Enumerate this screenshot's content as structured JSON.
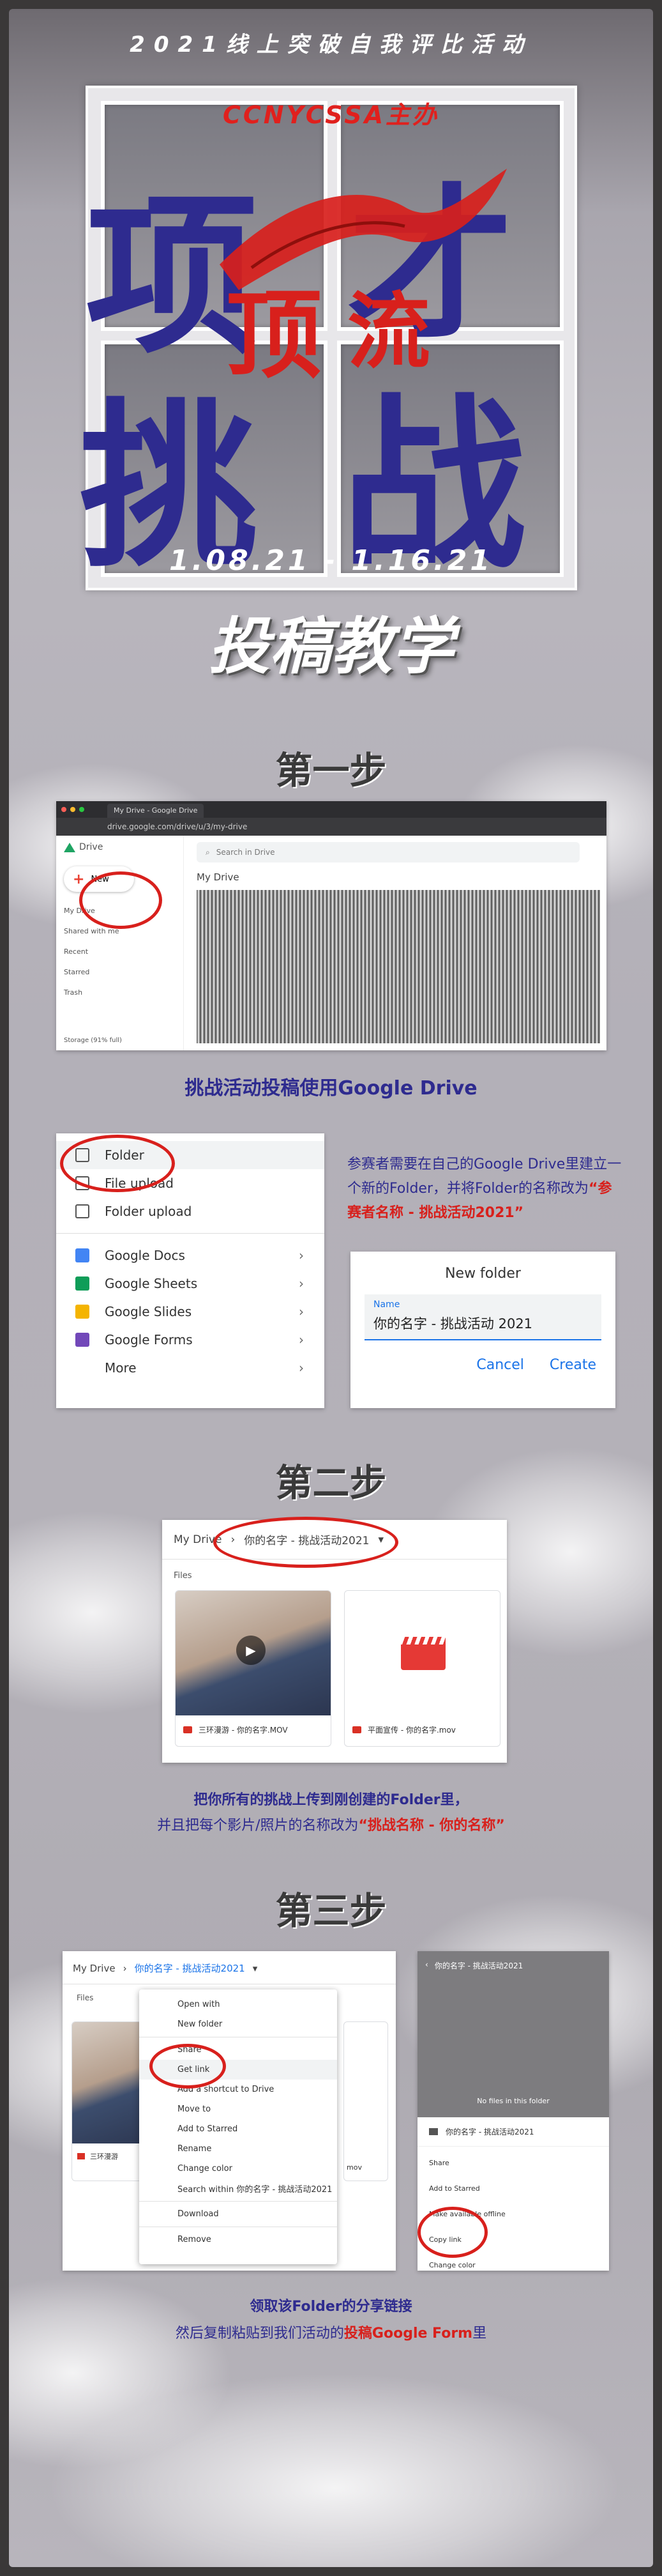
{
  "header": {
    "slogan": "2021线上突破自我评比活动",
    "organizer": "CCNYCSSA主办",
    "big_title_top": [
      "项",
      "才"
    ],
    "big_title_bottom": [
      "挑",
      "战"
    ],
    "big_title_red": [
      "顶",
      "流"
    ],
    "date_range": "1.08.21 - 1.16.21",
    "main_title": "投稿教学"
  },
  "steps": [
    {
      "title": "第一步"
    },
    {
      "title": "第二步"
    },
    {
      "title": "第三步"
    }
  ],
  "step1": {
    "browser": {
      "tab": "My Drive - Google Drive",
      "url": "drive.google.com/drive/u/3/my-drive",
      "app_name": "Drive",
      "search_placeholder": "Search in Drive",
      "breadcrumb": "My Drive",
      "new_button": "New",
      "nav": [
        "My Drive",
        "Shared with me",
        "Recent",
        "Starred",
        "Trash"
      ],
      "storage": "Storage (91% full)"
    },
    "caption": "挑战活动投稿使用Google Drive",
    "new_menu": {
      "items_top": [
        "Folder",
        "File upload",
        "Folder upload"
      ],
      "items_apps": [
        {
          "label": "Google Docs",
          "color": "#4285f4"
        },
        {
          "label": "Google Sheets",
          "color": "#0f9d58"
        },
        {
          "label": "Google Slides",
          "color": "#f4b400"
        },
        {
          "label": "Google Forms",
          "color": "#7248b9"
        },
        {
          "label": "More",
          "color": ""
        }
      ]
    },
    "description": {
      "line1": "参赛者需要在自己的Google Drive里建立一个新的Folder，并将Folder的名称改为",
      "highlight": "“参赛者名称 - 挑战活动2021”"
    },
    "new_folder_dialog": {
      "title": "New folder",
      "field_label": "Name",
      "field_value": "你的名字 - 挑战活动 2021",
      "cancel": "Cancel",
      "create": "Create"
    }
  },
  "step2": {
    "breadcrumb_root": "My Drive",
    "breadcrumb_folder": "你的名字 - 挑战活动2021",
    "section_label": "Files",
    "files": [
      {
        "name": "三环漫游 - 你的名字.MOV"
      },
      {
        "name": "平面宣传 - 你的名字.mov"
      }
    ],
    "caption_line1": "把你所有的挑战上传到刚创建的Folder里，",
    "caption_line2_pre": "并且把每个影片/照片的名称改为",
    "caption_line2_highlight": "“挑战名称 - 你的名称”"
  },
  "step3": {
    "breadcrumb_root": "My Drive",
    "breadcrumb_folder": "你的名字 - 挑战活动2021",
    "section_label": "Files",
    "file_left": "三环漫游",
    "file_right": "mov",
    "context_menu": [
      "Open with",
      "New folder",
      "Share",
      "Get link",
      "Add a shortcut to Drive",
      "Move to",
      "Add to Starred",
      "Rename",
      "Change color",
      "Search within 你的名字 - 挑战活动2021",
      "Download",
      "Remove"
    ],
    "mobile": {
      "header": "你的名字 - 挑战活动2021",
      "empty": "No files in this folder",
      "folder_name": "你的名字 - 挑战活动2021",
      "actions": [
        "Share",
        "Add to Starred",
        "Make available offline",
        "Copy link",
        "Change color"
      ]
    },
    "caption_line1": "领取该Folder的分享链接",
    "caption_line2_pre": "然后复制粘贴到我们活动的",
    "caption_line2_highlight": "投稿Google Form",
    "caption_line2_post": "里"
  }
}
